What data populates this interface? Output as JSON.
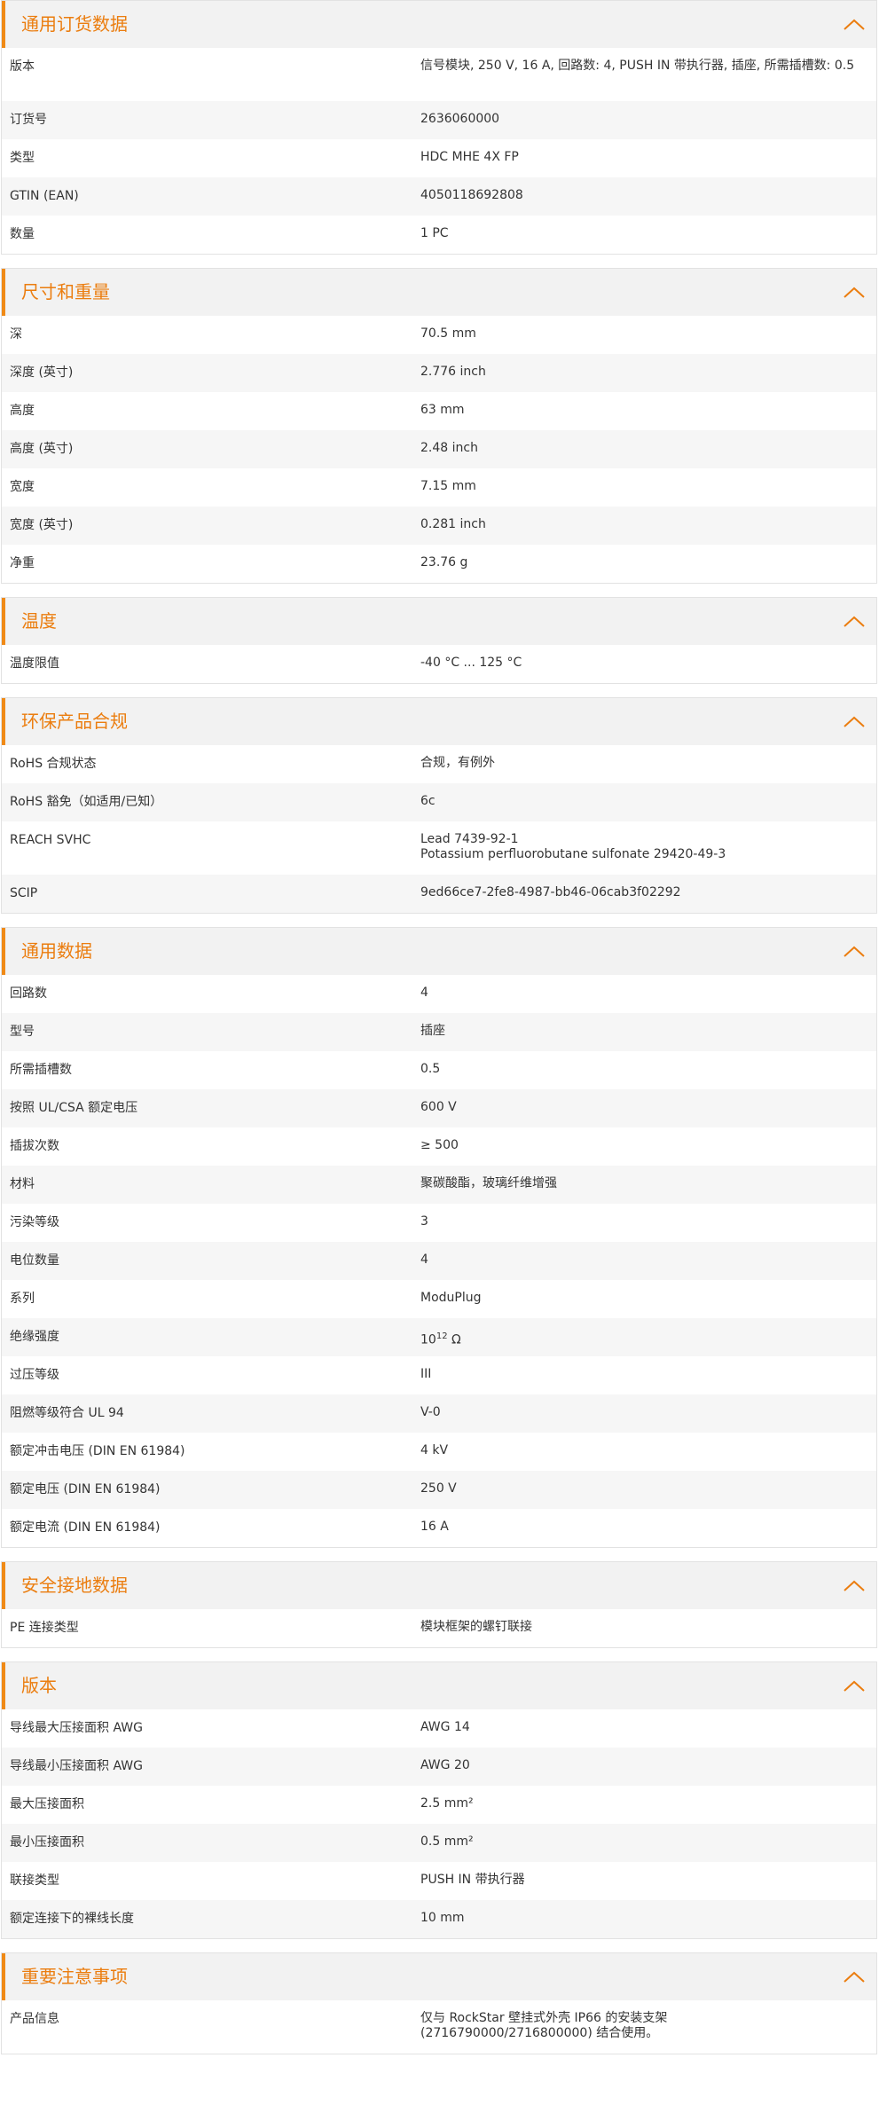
{
  "colors": {
    "accent": "#eb7d0f",
    "header_bg": "#f2f2f2",
    "alt_row_bg": "#f6f6f6"
  },
  "sections": [
    {
      "title": "通用订货数据",
      "rows": [
        {
          "label": "版本",
          "value": "信号模块, 250 V, 16 A, 回路数: 4, PUSH IN 带执行器, 插座, 所需插槽数: 0.5",
          "tall": true
        },
        {
          "label": "订货号",
          "value": "2636060000"
        },
        {
          "label": "类型",
          "value": "HDC MHE 4X FP"
        },
        {
          "label": "GTIN (EAN)",
          "value": "4050118692808"
        },
        {
          "label": "数量",
          "value": "1  PC"
        }
      ]
    },
    {
      "title": "尺寸和重量",
      "rows": [
        {
          "label": "深",
          "value": "70.5  mm"
        },
        {
          "label": "深度 (英寸)",
          "value": "2.776  inch"
        },
        {
          "label": "高度",
          "value": "63  mm"
        },
        {
          "label": "高度 (英寸)",
          "value": "2.48  inch"
        },
        {
          "label": "宽度",
          "value": "7.15  mm"
        },
        {
          "label": "宽度 (英寸)",
          "value": "0.281  inch"
        },
        {
          "label": "净重",
          "value": "23.76  g"
        }
      ]
    },
    {
      "title": "温度",
      "rows": [
        {
          "label": "温度限值",
          "value": "-40 °C ... 125 °C"
        }
      ]
    },
    {
      "title": "环保产品合规",
      "rows": [
        {
          "label": "RoHS 合规状态",
          "value": "合规，有例外"
        },
        {
          "label": "RoHS 豁免（如适用/已知）",
          "value": "6c"
        },
        {
          "label": "REACH SVHC",
          "value": "Lead 7439-92-1",
          "value2": "Potassium perfluorobutane sulfonate 29420-49-3",
          "tall": true
        },
        {
          "label": "SCIP",
          "value": "9ed66ce7-2fe8-4987-bb46-06cab3f02292"
        }
      ]
    },
    {
      "title": "通用数据",
      "rows": [
        {
          "label": "回路数",
          "value": "4"
        },
        {
          "label": "型号",
          "value": "插座"
        },
        {
          "label": "所需插槽数",
          "value": "0.5"
        },
        {
          "label": "按照 UL/CSA 额定电压",
          "value": "600 V"
        },
        {
          "label": "插拔次数",
          "value": "≥ 500"
        },
        {
          "label": "材料",
          "value": "聚碳酸酯，玻璃纤维增强"
        },
        {
          "label": "污染等级",
          "value": "3"
        },
        {
          "label": "电位数量",
          "value": "4"
        },
        {
          "label": "系列",
          "value": "ModuPlug"
        },
        {
          "label": "绝缘强度",
          "value": "10",
          "sup": "12",
          "value_suffix": " Ω"
        },
        {
          "label": "过压等级",
          "value": "III"
        },
        {
          "label": "阻燃等级符合 UL 94",
          "value": "V-0"
        },
        {
          "label": "额定冲击电压 (DIN EN 61984)",
          "value": "4  kV"
        },
        {
          "label": "额定电压 (DIN EN 61984)",
          "value": "250  V"
        },
        {
          "label": "额定电流 (DIN EN 61984)",
          "value": "16  A"
        }
      ]
    },
    {
      "title": "安全接地数据",
      "rows": [
        {
          "label": "PE 连接类型",
          "value": "模块框架的螺钉联接"
        }
      ]
    },
    {
      "title": "版本",
      "rows": [
        {
          "label": "导线最大压接面积 AWG",
          "value": "AWG 14"
        },
        {
          "label": "导线最小压接面积 AWG",
          "value": "AWG 20"
        },
        {
          "label": "最大压接面积",
          "value": "2.5  mm²"
        },
        {
          "label": "最小压接面积",
          "value": "0.5  mm²"
        },
        {
          "label": "联接类型",
          "value": "PUSH IN 带执行器"
        },
        {
          "label": "额定连接下的裸线长度",
          "value": "10  mm"
        }
      ]
    },
    {
      "title": "重要注意事项",
      "rows": [
        {
          "label": "产品信息",
          "value": "仅与 RockStar 壁挂式外壳 IP66 的安装支架",
          "value2": "(2716790000/2716800000) 结合使用。",
          "tall": true
        }
      ]
    }
  ]
}
